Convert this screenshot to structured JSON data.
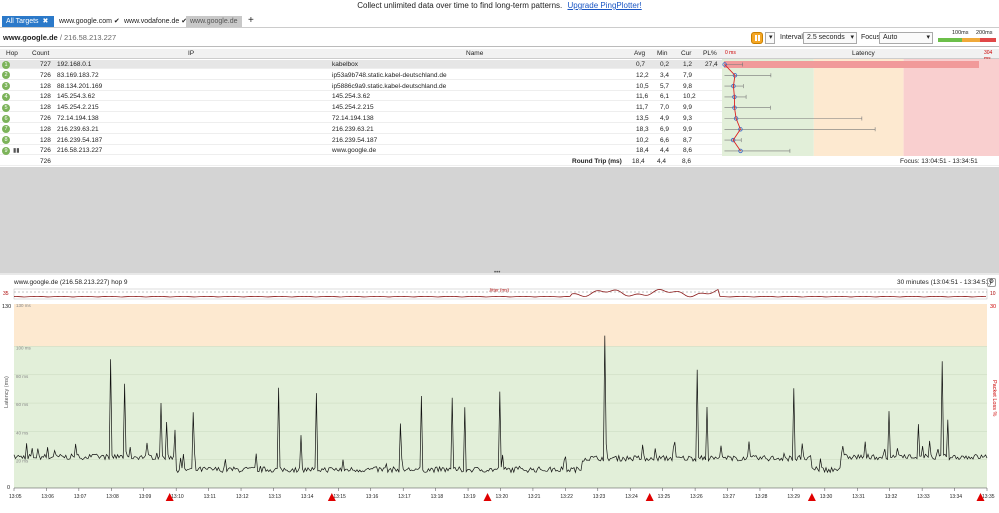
{
  "banner": {
    "message": "Collect unlimited data over time to find long-term patterns.",
    "link": "Upgrade PingPlotter!"
  },
  "tabs": [
    {
      "label": "All Targets",
      "close": "✖"
    },
    {
      "label": "www.google.com",
      "check": "✔"
    },
    {
      "label": "www.vodafone.de",
      "check": "✔"
    },
    {
      "label": "www.google.de"
    }
  ],
  "new_tab": "+",
  "toolbar": {
    "target": "www.google.de",
    "ip": " / 216.58.213.227",
    "interval_label": "Interval",
    "interval_value": "2.5 seconds",
    "focus_label": "Focus",
    "focus_value": "Auto",
    "scale_100": "100ms",
    "scale_200": "200ms"
  },
  "columns": {
    "hop": "Hop",
    "count": "Count",
    "ip": "IP",
    "name": "Name",
    "avg": "Avg",
    "min": "Min",
    "cur": "Cur",
    "pl": "PL%",
    "zero": "0 ms",
    "latency": "Latency",
    "max": "304 ms"
  },
  "hops": [
    {
      "hop": "1",
      "count": "727",
      "ip": "192.168.0.1",
      "name": "kabelbox",
      "avg": "0,7",
      "min": "0,2",
      "cur": "1,2",
      "pl": "27,4",
      "latency_ms": 0.7,
      "spread_ms": 20
    },
    {
      "hop": "2",
      "count": "726",
      "ip": "83.169.183.72",
      "name": "ip53a9b748.static.kabel-deutschland.de",
      "avg": "12,2",
      "min": "3,4",
      "cur": "7,9",
      "pl": "",
      "latency_ms": 12.2,
      "spread_ms": 40
    },
    {
      "hop": "3",
      "count": "128",
      "ip": "88.134.201.169",
      "name": "ip5886c9a9.static.kabel-deutschland.de",
      "avg": "10,5",
      "min": "5,7",
      "cur": "9,8",
      "pl": "",
      "latency_ms": 10.5,
      "spread_ms": 11
    },
    {
      "hop": "4",
      "count": "128",
      "ip": "145.254.3.62",
      "name": "145.254.3.62",
      "avg": "11,6",
      "min": "6,1",
      "cur": "10,2",
      "pl": "",
      "latency_ms": 11.6,
      "spread_ms": 13
    },
    {
      "hop": "5",
      "count": "128",
      "ip": "145.254.2.215",
      "name": "145.254.2.215",
      "avg": "11,7",
      "min": "7,0",
      "cur": "9,9",
      "pl": "",
      "latency_ms": 11.7,
      "spread_ms": 40
    },
    {
      "hop": "6",
      "count": "726",
      "ip": "72.14.194.138",
      "name": "72.14.194.138",
      "avg": "13,5",
      "min": "4,9",
      "cur": "9,3",
      "pl": "",
      "latency_ms": 13.5,
      "spread_ms": 140
    },
    {
      "hop": "7",
      "count": "128",
      "ip": "216.239.63.21",
      "name": "216.239.63.21",
      "avg": "18,3",
      "min": "6,9",
      "cur": "9,9",
      "pl": "",
      "latency_ms": 18.3,
      "spread_ms": 150
    },
    {
      "hop": "8",
      "count": "128",
      "ip": "216.239.54.187",
      "name": "216.239.54.187",
      "avg": "10,2",
      "min": "6,6",
      "cur": "8,7",
      "pl": "",
      "latency_ms": 10.2,
      "spread_ms": 9
    },
    {
      "hop": "9",
      "count": "726",
      "ip": "216.58.213.227",
      "name": "www.google.de",
      "avg": "18,4",
      "min": "4,4",
      "cur": "8,6",
      "pl": "",
      "latency_ms": 18.4,
      "spread_ms": 55
    }
  ],
  "summary": {
    "count": "726",
    "label": "Round Trip (ms)",
    "avg": "18,4",
    "min": "4,4",
    "cur": "8,6",
    "focus": "Focus: 13:04:51 - 13:34:51"
  },
  "divider_dots": "•••",
  "graph": {
    "title": "www.google.de (216.58.213.227) hop 9",
    "range": "30 minutes (13:04:51 - 13:34:51)",
    "jitter_label": "Jitter (ms)",
    "jitter_axis": "35",
    "jitter_axis_right": "10",
    "y_top": "130",
    "y_right_top": "30",
    "y_label": "Latency (ms)",
    "y_label_right": "Packet Loss %",
    "y_ticks": [
      "130 ms",
      "100 ms",
      "80 ms",
      "60 ms",
      "40 ms",
      "20 ms"
    ],
    "zero": "0",
    "x_ticks": [
      "13:05",
      "13:06",
      "13:07",
      "13:08",
      "13:09",
      "13:10",
      "13:11",
      "13:12",
      "13:13",
      "13:14",
      "13:15",
      "13:16",
      "13:17",
      "13:18",
      "13:19",
      "13:20",
      "13:21",
      "13:22",
      "13:23",
      "13:24",
      "13:25",
      "13:26",
      "13:27",
      "13:28",
      "13:29",
      "13:30",
      "13:31",
      "13:32",
      "13:33",
      "13:34",
      "13:35"
    ],
    "loss_markers_min": [
      4.8,
      9.8,
      14.6,
      19.6,
      24.6,
      29.8
    ]
  },
  "colors": {
    "good": "#e2efd9",
    "warn": "#fde9d0",
    "bad": "#f9cfcf",
    "accent": "#2b79c9",
    "hop": "#7cb35a",
    "line": "#111111",
    "loss": "#e00000"
  }
}
